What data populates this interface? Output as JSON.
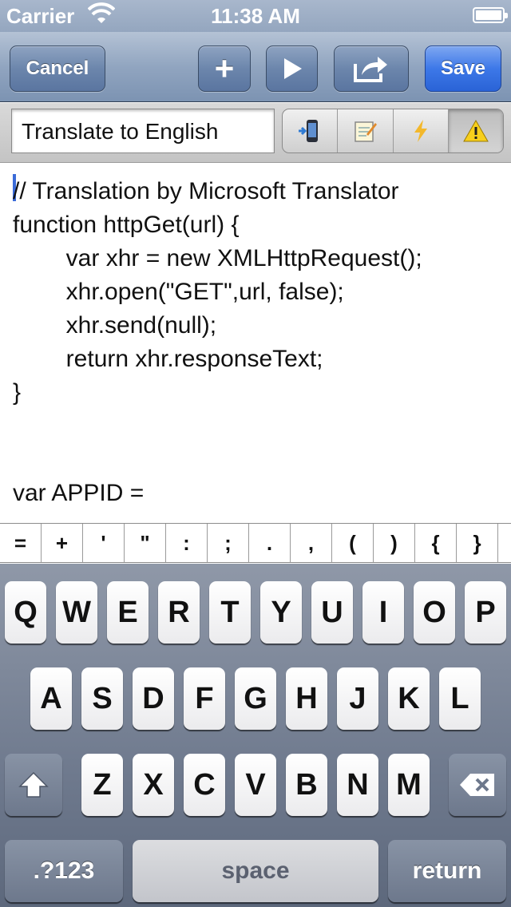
{
  "status_bar": {
    "carrier": "Carrier",
    "time": "11:38 AM"
  },
  "toolbar": {
    "cancel_label": "Cancel",
    "add_label": "+",
    "save_label": "Save",
    "icons": [
      "plus-icon",
      "play-icon",
      "share-icon"
    ]
  },
  "script": {
    "title": "Translate to English",
    "segments": [
      "device-icon",
      "notes-icon",
      "lightning-icon",
      "warning-icon"
    ]
  },
  "editor": {
    "lines": [
      "// Translation by Microsoft Translator",
      "function httpGet(url) {",
      "        var xhr = new XMLHttpRequest();",
      "        xhr.open(\"GET\",url, false);",
      "        xhr.send(null);",
      "        return xhr.responseText;",
      "}",
      "",
      "",
      "var APPID ="
    ]
  },
  "accessory_keys": [
    "=",
    "+",
    "'",
    "\"",
    ":",
    ";",
    ".",
    ",",
    "(",
    ")",
    "{",
    "}"
  ],
  "keyboard": {
    "row1": [
      "Q",
      "W",
      "E",
      "R",
      "T",
      "Y",
      "U",
      "I",
      "O",
      "P"
    ],
    "row2": [
      "A",
      "S",
      "D",
      "F",
      "G",
      "H",
      "J",
      "K",
      "L"
    ],
    "row3": [
      "Z",
      "X",
      "C",
      "V",
      "B",
      "N",
      "M"
    ],
    "numbers_label": ".?123",
    "space_label": "space",
    "return_label": "return"
  },
  "colors": {
    "save_button": "#2a63d6",
    "caret": "#3b6bd8"
  }
}
